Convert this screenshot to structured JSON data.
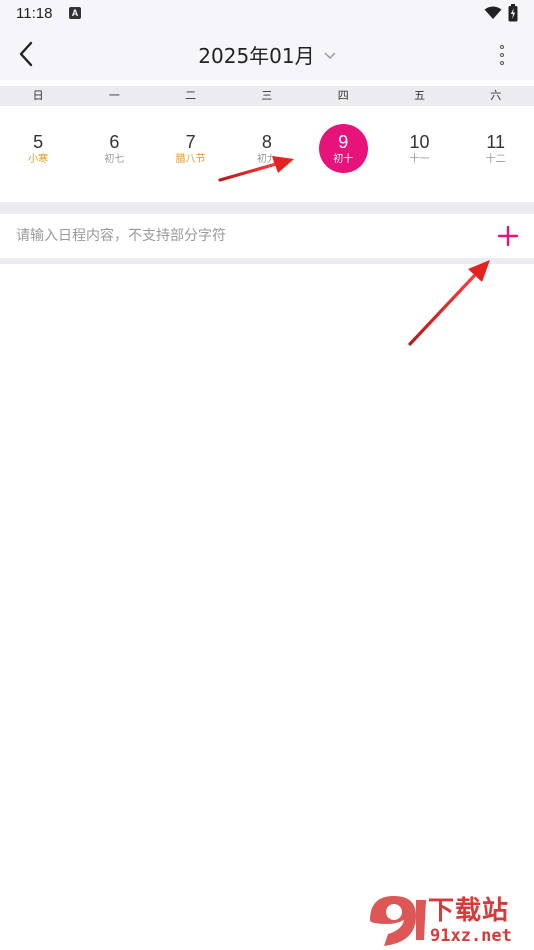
{
  "status_bar": {
    "time": "11:18",
    "notification_icon": "a-letter-icon",
    "wifi_icon": "wifi-icon",
    "battery_icon": "battery-charging-icon"
  },
  "header": {
    "title": "2025年01月",
    "back_icon": "back-chevron-icon",
    "dropdown_icon": "chevron-down-icon",
    "menu_icon": "more-vertical-icon"
  },
  "weekdays": [
    "日",
    "一",
    "二",
    "三",
    "四",
    "五",
    "六"
  ],
  "dates": [
    {
      "day": "5",
      "lunar": "小寒",
      "term": true,
      "selected": false
    },
    {
      "day": "6",
      "lunar": "初七",
      "term": false,
      "selected": false
    },
    {
      "day": "7",
      "lunar": "腊八节",
      "term": true,
      "selected": false
    },
    {
      "day": "8",
      "lunar": "初九",
      "term": false,
      "selected": false
    },
    {
      "day": "9",
      "lunar": "初十",
      "term": false,
      "selected": true
    },
    {
      "day": "10",
      "lunar": "十一",
      "term": false,
      "selected": false
    },
    {
      "day": "11",
      "lunar": "十二",
      "term": false,
      "selected": false
    }
  ],
  "schedule": {
    "placeholder": "请输入日程内容，不支持部分字符",
    "value": "",
    "add_icon": "plus-icon"
  },
  "colors": {
    "accent": "#e6137a",
    "festival": "#e8962a",
    "annotation_arrow": "#e02020"
  },
  "watermark": {
    "logo_text": "9",
    "brand": "下载站",
    "domain": "91xz.net"
  }
}
